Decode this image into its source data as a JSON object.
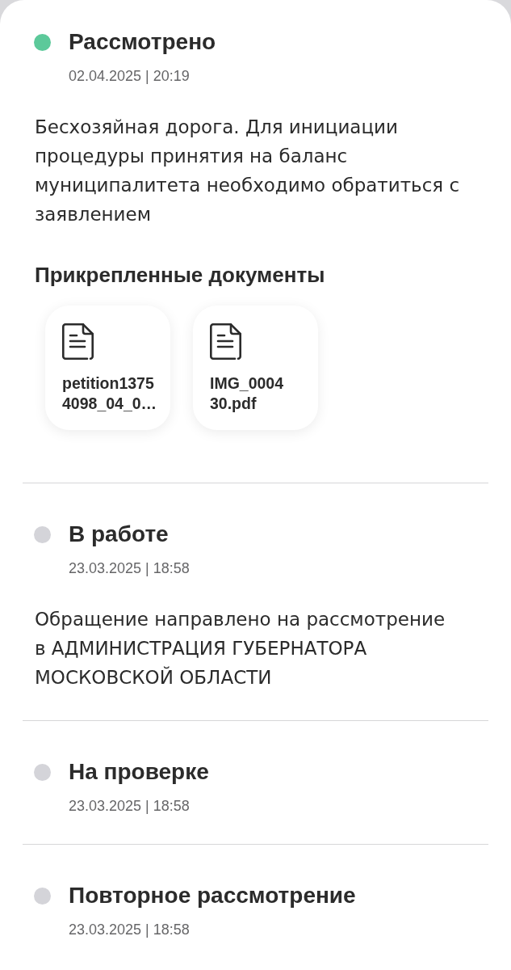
{
  "events": [
    {
      "status": "Рассмотрено",
      "color": "#5cc99a",
      "date": "02.04.2025 | 20:19",
      "description": "Бесхозяйная дорога. Для инициации процедуры принятия на баланс муниципалитета необходимо обратиться с заявлением",
      "attachments": {
        "title": "Прикрепленные документы",
        "files": [
          {
            "name": "petition1375\n4098_04_0…"
          },
          {
            "name": "IMG_0004\n30.pdf"
          }
        ]
      }
    },
    {
      "status": "В работе",
      "color": "#d4d4d9",
      "date": "23.03.2025 | 18:58",
      "description": "Обращение направлено на рассмотрение в АДМИНИСТРАЦИЯ ГУБЕРНАТОРА МОСКОВСКОЙ ОБЛАСТИ"
    },
    {
      "status": "На проверке",
      "color": "#d4d4d9",
      "date": "23.03.2025 | 18:58"
    },
    {
      "status": "Повторное рассмотрение",
      "color": "#d4d4d9",
      "date": "23.03.2025 | 18:58"
    }
  ]
}
